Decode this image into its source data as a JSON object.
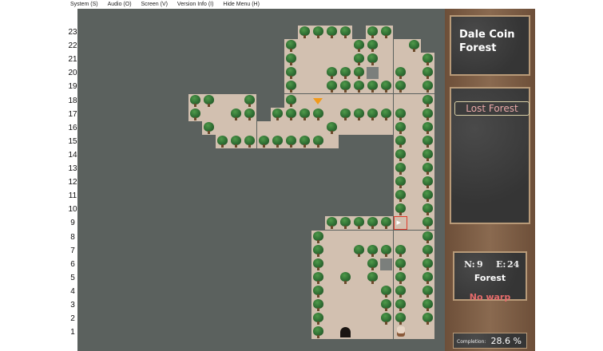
{
  "menu": {
    "system": "System (S)",
    "audio": "Audio (O)",
    "screen": "Screen (V)",
    "version": "Version Info (I)",
    "hide": "Hide Menu (H)"
  },
  "rows": [
    "23",
    "22",
    "21",
    "20",
    "19",
    "18",
    "17",
    "16",
    "15",
    "14",
    "13",
    "12",
    "11",
    "10",
    "9",
    "8",
    "7",
    "6",
    "5",
    "4",
    "3",
    "2",
    "1"
  ],
  "panel": {
    "region_name": "Dale Coin Forest",
    "area_name": "Lost Forest",
    "north_label": "N:",
    "north_value": "9",
    "east_label": "E:",
    "east_value": "24",
    "terrain": "Forest",
    "warp_status": "No warp",
    "completion_label": "Completion:",
    "completion_value": "28.6 %"
  },
  "colors": {
    "background": "#5b615e",
    "floor": "#d2c0b0",
    "tree": "#2f6e33",
    "warp_text": "#e46a6a",
    "marker": "#f29a1a",
    "cursor": "#e03a2a"
  }
}
